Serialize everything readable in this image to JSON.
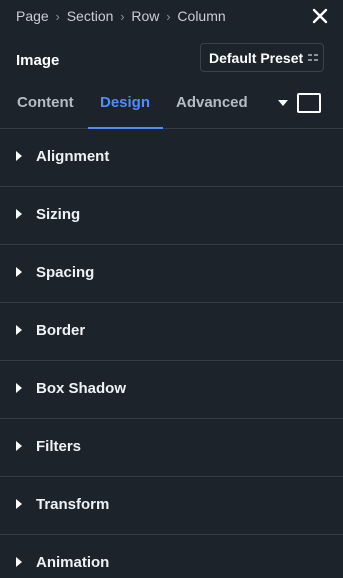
{
  "breadcrumb": {
    "items": [
      "Page",
      "Section",
      "Row",
      "Column"
    ],
    "separator": "›"
  },
  "header": {
    "title": "Image",
    "preset_label": "Default Preset"
  },
  "tabs": [
    {
      "label": "Content",
      "active": false
    },
    {
      "label": "Design",
      "active": true
    },
    {
      "label": "Advanced",
      "active": false
    }
  ],
  "sections": [
    {
      "label": "Alignment"
    },
    {
      "label": "Sizing"
    },
    {
      "label": "Spacing"
    },
    {
      "label": "Border"
    },
    {
      "label": "Box Shadow"
    },
    {
      "label": "Filters"
    },
    {
      "label": "Transform"
    },
    {
      "label": "Animation"
    }
  ],
  "icons": {
    "close": "close-icon",
    "preset": "preset-options-icon",
    "tab_more": "dropdown-arrow-icon",
    "view_toggle": "desktop-view-icon",
    "section_toggle": "caret-right-icon"
  },
  "colors": {
    "background": "#1d232b",
    "accent": "#4f8dff",
    "divider": "#353c47"
  }
}
